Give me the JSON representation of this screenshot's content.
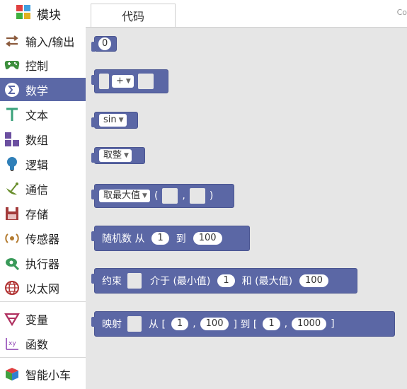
{
  "sidebar": {
    "header_label": "模块",
    "items": [
      {
        "label": "输入/输出",
        "icon": "arrows-exchange-icon",
        "color": "#8b5a3c"
      },
      {
        "label": "控制",
        "icon": "gamepad-icon",
        "color": "#3d8f3d"
      },
      {
        "label": "数学",
        "icon": "math-sigma-icon",
        "color": "#ffffff"
      },
      {
        "label": "文本",
        "icon": "text-t-icon",
        "color": "#3aa17a"
      },
      {
        "label": "数组",
        "icon": "array-blocks-icon",
        "color": "#6b4fa0"
      },
      {
        "label": "逻辑",
        "icon": "lightbulb-icon",
        "color": "#2f7fb8"
      },
      {
        "label": "通信",
        "icon": "satellite-icon",
        "color": "#6a8f2e"
      },
      {
        "label": "存储",
        "icon": "floppy-icon",
        "color": "#a33a3a"
      },
      {
        "label": "传感器",
        "icon": "sensor-icon",
        "color": "#b37a2e"
      },
      {
        "label": "执行器",
        "icon": "actuator-icon",
        "color": "#3a9a5a"
      },
      {
        "label": "以太网",
        "icon": "globe-icon",
        "color": "#b03030"
      },
      {
        "label": "变量",
        "icon": "variable-icon",
        "color": "#b03060"
      },
      {
        "label": "函数",
        "icon": "function-xy-icon",
        "color": "#8a3ab0"
      },
      {
        "label": "智能小车",
        "icon": "cube-icon",
        "color": "#2f7fd0"
      }
    ]
  },
  "tabs": {
    "code_label": "代码",
    "cut_text": "Co"
  },
  "blocks": {
    "number": {
      "value": "0"
    },
    "arith": {
      "op": "+"
    },
    "trig": {
      "fn": "sin"
    },
    "round": {
      "fn": "取整"
    },
    "minmax": {
      "fn": "取最大值",
      "open": "(",
      "comma": ",",
      "close": ")"
    },
    "random": {
      "label": "随机数 从",
      "from": "1",
      "to_label": "到",
      "to": "100"
    },
    "constrain": {
      "label": "约束",
      "between": "介于 (最小值)",
      "min": "1",
      "and": "和 (最大值)",
      "max": "100"
    },
    "map": {
      "label": "映射",
      "from": "从 [",
      "a": "1",
      "comma1": ",",
      "b": "100",
      "to": "] 到 [",
      "c": "1",
      "comma2": ",",
      "d": "1000",
      "close": "]"
    }
  }
}
